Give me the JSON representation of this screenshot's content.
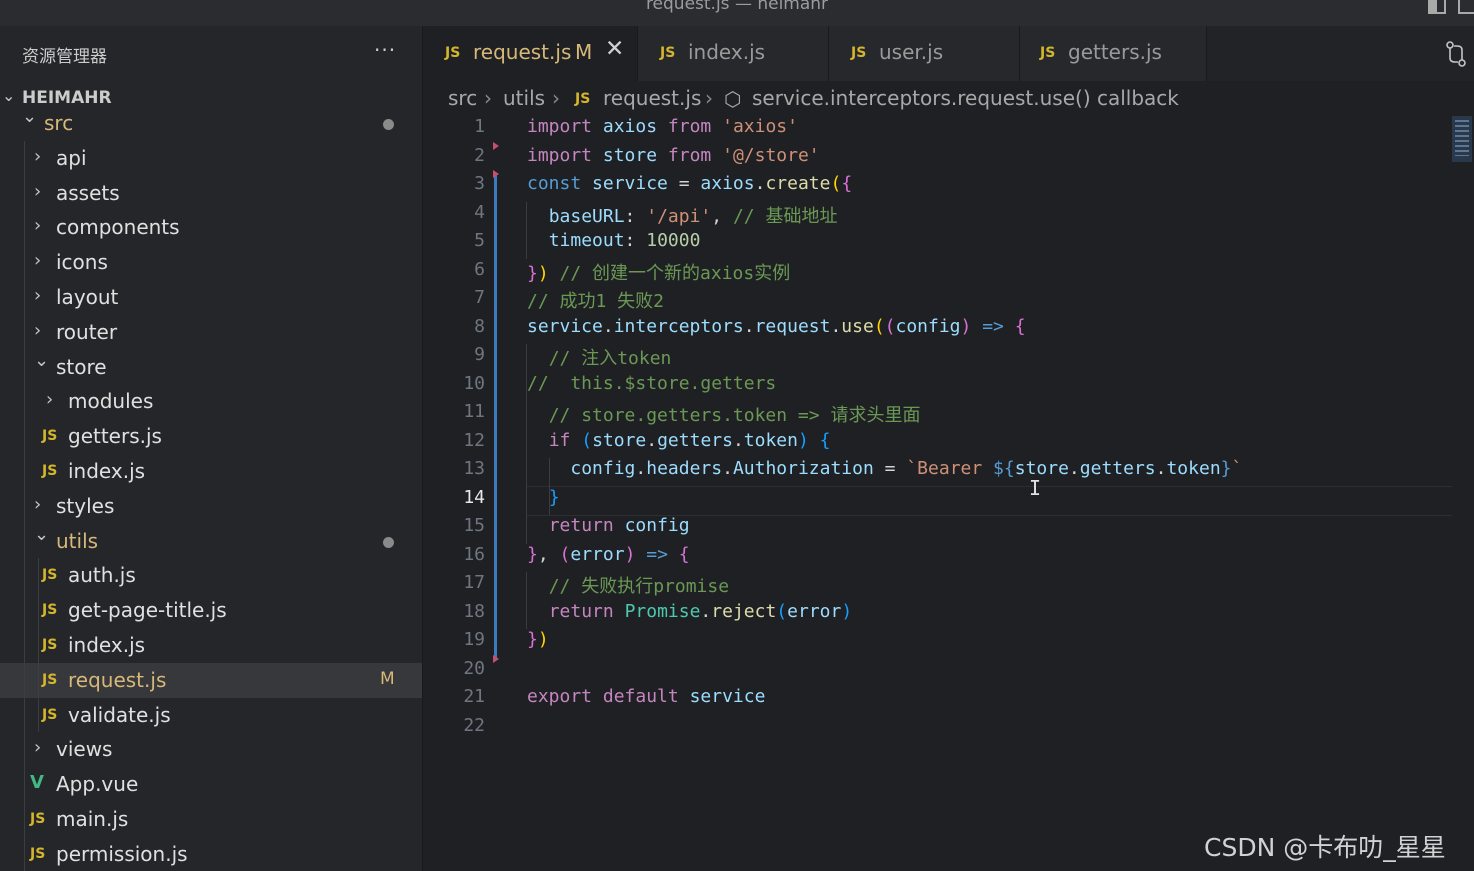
{
  "window": {
    "title": "request.js — heimahr"
  },
  "sidebar": {
    "title": "资源管理器",
    "more": "···",
    "root": "HEIMAHR",
    "items": [
      {
        "label": "src",
        "kind": "folder",
        "open": true,
        "depth": 0,
        "git": true,
        "dot": true
      },
      {
        "label": "api",
        "kind": "folder",
        "open": false,
        "depth": 1
      },
      {
        "label": "assets",
        "kind": "folder",
        "open": false,
        "depth": 1
      },
      {
        "label": "components",
        "kind": "folder",
        "open": false,
        "depth": 1
      },
      {
        "label": "icons",
        "kind": "folder",
        "open": false,
        "depth": 1
      },
      {
        "label": "layout",
        "kind": "folder",
        "open": false,
        "depth": 1
      },
      {
        "label": "router",
        "kind": "folder",
        "open": false,
        "depth": 1
      },
      {
        "label": "store",
        "kind": "folder",
        "open": true,
        "depth": 1
      },
      {
        "label": "modules",
        "kind": "folder",
        "open": false,
        "depth": 2
      },
      {
        "label": "getters.js",
        "kind": "js",
        "depth": 2
      },
      {
        "label": "index.js",
        "kind": "js",
        "depth": 2
      },
      {
        "label": "styles",
        "kind": "folder",
        "open": false,
        "depth": 1
      },
      {
        "label": "utils",
        "kind": "folder",
        "open": true,
        "depth": 1,
        "git": true,
        "dot": true
      },
      {
        "label": "auth.js",
        "kind": "js",
        "depth": 2
      },
      {
        "label": "get-page-title.js",
        "kind": "js",
        "depth": 2
      },
      {
        "label": "index.js",
        "kind": "js",
        "depth": 2
      },
      {
        "label": "request.js",
        "kind": "js",
        "depth": 2,
        "git": true,
        "active": true,
        "badge": "M"
      },
      {
        "label": "validate.js",
        "kind": "js",
        "depth": 2
      },
      {
        "label": "views",
        "kind": "folder",
        "open": false,
        "depth": 1
      },
      {
        "label": "App.vue",
        "kind": "vue",
        "depth": 1
      },
      {
        "label": "main.js",
        "kind": "js",
        "depth": 1
      },
      {
        "label": "permission.js",
        "kind": "js",
        "depth": 1
      }
    ]
  },
  "tabs": [
    {
      "label": "request.js",
      "badge": "M",
      "close": "✕",
      "active": true
    },
    {
      "label": "index.js"
    },
    {
      "label": "user.js"
    },
    {
      "label": "getters.js"
    }
  ],
  "js_icon": "JS",
  "vue_icon": "V",
  "breadcrumb": {
    "items": [
      "src",
      "utils",
      "request.js",
      "service.interceptors.request.use() callback"
    ]
  },
  "editor": {
    "current_line": 14,
    "lines": [
      {
        "n": "1",
        "tokens": [
          [
            "k",
            "import"
          ],
          [
            "o",
            " "
          ],
          [
            "v",
            "axios"
          ],
          [
            "o",
            " "
          ],
          [
            "k",
            "from"
          ],
          [
            "o",
            " "
          ],
          [
            "s",
            "'axios'"
          ]
        ]
      },
      {
        "n": "2",
        "tokens": [
          [
            "k",
            "import"
          ],
          [
            "o",
            " "
          ],
          [
            "v",
            "store"
          ],
          [
            "o",
            " "
          ],
          [
            "k",
            "from"
          ],
          [
            "o",
            " "
          ],
          [
            "s",
            "'@/store'"
          ]
        ]
      },
      {
        "n": "3",
        "tokens": [
          [
            "kw",
            "const"
          ],
          [
            "o",
            " "
          ],
          [
            "v",
            "service"
          ],
          [
            "o",
            " = "
          ],
          [
            "v",
            "axios"
          ],
          [
            "o",
            "."
          ],
          [
            "f",
            "create"
          ],
          [
            "p",
            "("
          ],
          [
            "p2",
            "{"
          ]
        ]
      },
      {
        "n": "4",
        "tokens": [
          [
            "o",
            "  "
          ],
          [
            "v",
            "baseURL"
          ],
          [
            "o",
            ": "
          ],
          [
            "s",
            "'/api'"
          ],
          [
            "o",
            ", "
          ],
          [
            "c",
            "// 基础地址"
          ]
        ]
      },
      {
        "n": "5",
        "tokens": [
          [
            "o",
            "  "
          ],
          [
            "v",
            "timeout"
          ],
          [
            "o",
            ": "
          ],
          [
            "n",
            "10000"
          ]
        ]
      },
      {
        "n": "6",
        "tokens": [
          [
            "p2",
            "}"
          ],
          [
            "p",
            ")"
          ],
          [
            "o",
            " "
          ],
          [
            "c",
            "// 创建一个新的axios实例"
          ]
        ]
      },
      {
        "n": "7",
        "tokens": [
          [
            "c",
            "// 成功1 失败2"
          ]
        ]
      },
      {
        "n": "8",
        "tokens": [
          [
            "v",
            "service"
          ],
          [
            "o",
            "."
          ],
          [
            "v",
            "interceptors"
          ],
          [
            "o",
            "."
          ],
          [
            "v",
            "request"
          ],
          [
            "o",
            "."
          ],
          [
            "f",
            "use"
          ],
          [
            "p",
            "("
          ],
          [
            "p2",
            "("
          ],
          [
            "v",
            "config"
          ],
          [
            "p2",
            ")"
          ],
          [
            "o",
            " "
          ],
          [
            "kw",
            "=>"
          ],
          [
            "o",
            " "
          ],
          [
            "p2",
            "{"
          ]
        ]
      },
      {
        "n": "9",
        "tokens": [
          [
            "o",
            "  "
          ],
          [
            "c",
            "// 注入token"
          ]
        ]
      },
      {
        "n": "10",
        "tokens": [
          [
            "c",
            "//  this.$store.getters"
          ]
        ]
      },
      {
        "n": "11",
        "tokens": [
          [
            "o",
            "  "
          ],
          [
            "c",
            "// store.getters.token => 请求头里面"
          ]
        ]
      },
      {
        "n": "12",
        "tokens": [
          [
            "o",
            "  "
          ],
          [
            "k",
            "if"
          ],
          [
            "o",
            " "
          ],
          [
            "p3",
            "("
          ],
          [
            "v",
            "store"
          ],
          [
            "o",
            "."
          ],
          [
            "v",
            "getters"
          ],
          [
            "o",
            "."
          ],
          [
            "v",
            "token"
          ],
          [
            "p3",
            ")"
          ],
          [
            "o",
            " "
          ],
          [
            "p3",
            "{"
          ]
        ]
      },
      {
        "n": "13",
        "tokens": [
          [
            "o",
            "    "
          ],
          [
            "v",
            "config"
          ],
          [
            "o",
            "."
          ],
          [
            "v",
            "headers"
          ],
          [
            "o",
            "."
          ],
          [
            "v",
            "Authorization"
          ],
          [
            "o",
            " = "
          ],
          [
            "s",
            "`Bearer "
          ],
          [
            "kw",
            "${"
          ],
          [
            "v",
            "store"
          ],
          [
            "o",
            "."
          ],
          [
            "v",
            "getters"
          ],
          [
            "o",
            "."
          ],
          [
            "v",
            "token"
          ],
          [
            "kw",
            "}"
          ],
          [
            "s",
            "`"
          ]
        ]
      },
      {
        "n": "14",
        "tokens": [
          [
            "o",
            "  "
          ],
          [
            "p3",
            "}"
          ]
        ]
      },
      {
        "n": "15",
        "tokens": [
          [
            "o",
            "  "
          ],
          [
            "k",
            "return"
          ],
          [
            "o",
            " "
          ],
          [
            "v",
            "config"
          ]
        ]
      },
      {
        "n": "16",
        "tokens": [
          [
            "p2",
            "}"
          ],
          [
            "o",
            ", "
          ],
          [
            "p2",
            "("
          ],
          [
            "v",
            "error"
          ],
          [
            "p2",
            ")"
          ],
          [
            "o",
            " "
          ],
          [
            "kw",
            "=>"
          ],
          [
            "o",
            " "
          ],
          [
            "p2",
            "{"
          ]
        ]
      },
      {
        "n": "17",
        "tokens": [
          [
            "o",
            "  "
          ],
          [
            "c",
            "// 失败执行promise"
          ]
        ]
      },
      {
        "n": "18",
        "tokens": [
          [
            "o",
            "  "
          ],
          [
            "k",
            "return"
          ],
          [
            "o",
            " "
          ],
          [
            "t",
            "Promise"
          ],
          [
            "o",
            "."
          ],
          [
            "f",
            "reject"
          ],
          [
            "p3",
            "("
          ],
          [
            "v",
            "error"
          ],
          [
            "p3",
            ")"
          ]
        ]
      },
      {
        "n": "19",
        "tokens": [
          [
            "p2",
            "}"
          ],
          [
            "p",
            ")"
          ]
        ]
      },
      {
        "n": "20",
        "tokens": []
      },
      {
        "n": "21",
        "tokens": [
          [
            "k",
            "export"
          ],
          [
            "o",
            " "
          ],
          [
            "k",
            "default"
          ],
          [
            "o",
            " "
          ],
          [
            "v",
            "service"
          ]
        ]
      },
      {
        "n": "22",
        "tokens": []
      }
    ]
  },
  "cursor_glyph": "I",
  "icons": {
    "chevron_right": "›",
    "chevron_down": "⌄",
    "cube": "⬡"
  },
  "watermark": "CSDN @卡布叻_星星"
}
